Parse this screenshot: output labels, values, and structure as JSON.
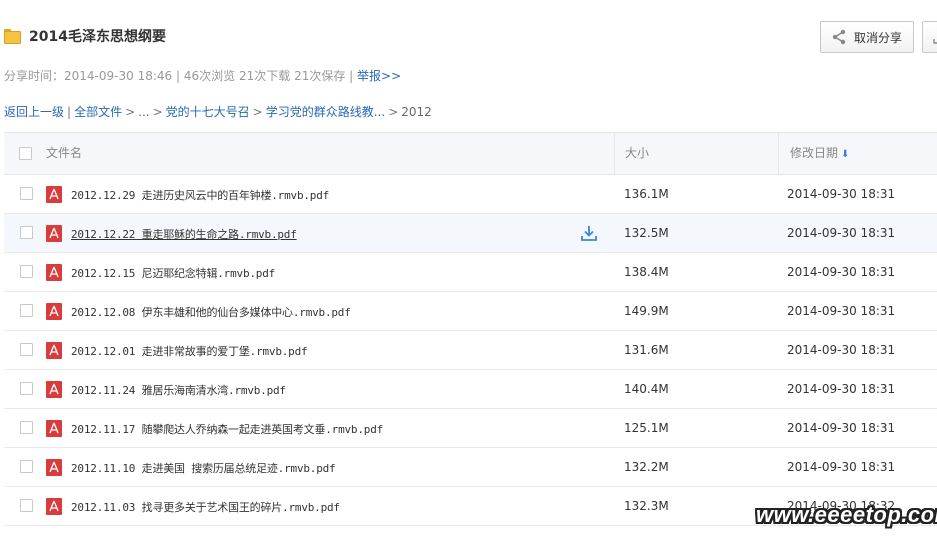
{
  "header": {
    "title": "2014毛泽东思想纲要",
    "share_button_label": "取消分享"
  },
  "meta": {
    "share_time_label": "分享时间：",
    "share_time": "2014-09-30 18:46",
    "views": "46次浏览",
    "downloads": "21次下载",
    "saves": "21次保存",
    "report_link": "举报>>"
  },
  "breadcrumb": {
    "back": "返回上一级",
    "all_files": "全部文件",
    "ellipsis": "...",
    "level1": "党的十七大号召",
    "level2": "学习党的群众路线教...",
    "current": "2012"
  },
  "table": {
    "headers": {
      "name": "文件名",
      "size": "大小",
      "date": "修改日期"
    },
    "rows": [
      {
        "name": "2012.12.29 走进历史风云中的百年钟楼.rmvb.pdf",
        "size": "136.1M",
        "date": "2014-09-30 18:31"
      },
      {
        "name": "2012.12.22 重走耶稣的生命之路.rmvb.pdf",
        "size": "132.5M",
        "date": "2014-09-30 18:31"
      },
      {
        "name": "2012.12.15 尼迈耶纪念特辑.rmvb.pdf",
        "size": "138.4M",
        "date": "2014-09-30 18:31"
      },
      {
        "name": "2012.12.08 伊东丰雄和他的仙台多媒体中心.rmvb.pdf",
        "size": "149.9M",
        "date": "2014-09-30 18:31"
      },
      {
        "name": "2012.12.01 走进非常故事的爱丁堡.rmvb.pdf",
        "size": "131.6M",
        "date": "2014-09-30 18:31"
      },
      {
        "name": "2012.11.24 雅居乐海南清水湾.rmvb.pdf",
        "size": "140.4M",
        "date": "2014-09-30 18:31"
      },
      {
        "name": "2012.11.17 随攀爬达人乔纳森一起走进英国考文垂.rmvb.pdf",
        "size": "125.1M",
        "date": "2014-09-30 18:31"
      },
      {
        "name": "2012.11.10 走进美国 搜索历届总统足迹.rmvb.pdf",
        "size": "132.2M",
        "date": "2014-09-30 18:31"
      },
      {
        "name": "2012.11.03 找寻更多关于艺术国王的碎片.rmvb.pdf",
        "size": "132.3M",
        "date": "2014-09-30 18:32"
      }
    ]
  },
  "watermark": "www.eeeetop.com",
  "icons": {
    "folder": "folder-icon",
    "share": "share-icon",
    "pdf": "pdf-file-icon",
    "download": "download-icon",
    "sort": "sort-down-arrow-icon"
  },
  "colors": {
    "link": "#2768b5",
    "pdf_red": "#d93c3c",
    "folder_yellow": "#f5c243",
    "header_bg": "#f5f7fa",
    "hover_row_bg": "#f4f8fd"
  }
}
